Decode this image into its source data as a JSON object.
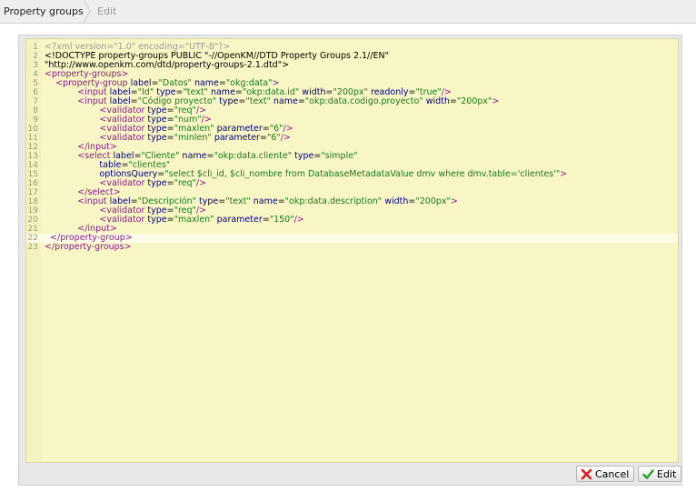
{
  "tabs": {
    "active": "Property groups",
    "inactive": "Edit"
  },
  "editor": {
    "lines": [
      {
        "n": "1",
        "segs": [
          [
            "meta",
            "<?xml version=\"1.0\" encoding=\"UTF-8\"?>"
          ]
        ]
      },
      {
        "n": "2",
        "segs": [
          [
            "text",
            "<!DOCTYPE property-groups PUBLIC \"-//OpenKM//DTD Property Groups 2.1//EN\""
          ]
        ]
      },
      {
        "n": "3",
        "segs": [
          [
            "text",
            "\"http://www.openkm.com/dtd/property-groups-2.1.dtd\">"
          ]
        ]
      },
      {
        "n": "4",
        "segs": [
          [
            "tag",
            "<property-groups>"
          ]
        ]
      },
      {
        "n": "5",
        "segs": [
          [
            "text",
            "    "
          ],
          [
            "tag",
            "<property-group "
          ],
          [
            "attr",
            "label"
          ],
          [
            "text",
            "="
          ],
          [
            "val",
            "\"Datos\""
          ],
          [
            "text",
            " "
          ],
          [
            "attr",
            "name"
          ],
          [
            "text",
            "="
          ],
          [
            "val",
            "\"okg:data\""
          ],
          [
            "tag",
            ">"
          ]
        ]
      },
      {
        "n": "6",
        "segs": [
          [
            "text",
            "            "
          ],
          [
            "tag",
            "<input "
          ],
          [
            "attr",
            "label"
          ],
          [
            "text",
            "="
          ],
          [
            "val",
            "\"Id\""
          ],
          [
            "text",
            " "
          ],
          [
            "attr",
            "type"
          ],
          [
            "text",
            "="
          ],
          [
            "val",
            "\"text\""
          ],
          [
            "text",
            " "
          ],
          [
            "attr",
            "name"
          ],
          [
            "text",
            "="
          ],
          [
            "val",
            "\"okp:data.id\""
          ],
          [
            "text",
            " "
          ],
          [
            "attr",
            "width"
          ],
          [
            "text",
            "="
          ],
          [
            "val",
            "\"200px\""
          ],
          [
            "text",
            " "
          ],
          [
            "attr",
            "readonly"
          ],
          [
            "text",
            "="
          ],
          [
            "val",
            "\"true\""
          ],
          [
            "tag",
            "/>"
          ]
        ]
      },
      {
        "n": "7",
        "segs": [
          [
            "text",
            "            "
          ],
          [
            "tag",
            "<input "
          ],
          [
            "attr",
            "label"
          ],
          [
            "text",
            "="
          ],
          [
            "val",
            "\"Código proyecto\""
          ],
          [
            "text",
            " "
          ],
          [
            "attr",
            "type"
          ],
          [
            "text",
            "="
          ],
          [
            "val",
            "\"text\""
          ],
          [
            "text",
            " "
          ],
          [
            "attr",
            "name"
          ],
          [
            "text",
            "="
          ],
          [
            "val",
            "\"okp:data.codigo.proyecto\""
          ],
          [
            "text",
            " "
          ],
          [
            "attr",
            "width"
          ],
          [
            "text",
            "="
          ],
          [
            "val",
            "\"200px\""
          ],
          [
            "tag",
            ">"
          ]
        ]
      },
      {
        "n": "8",
        "segs": [
          [
            "text",
            "                    "
          ],
          [
            "tag",
            "<validator "
          ],
          [
            "attr",
            "type"
          ],
          [
            "text",
            "="
          ],
          [
            "val",
            "\"req\""
          ],
          [
            "tag",
            "/>"
          ]
        ]
      },
      {
        "n": "9",
        "segs": [
          [
            "text",
            "                    "
          ],
          [
            "tag",
            "<validator "
          ],
          [
            "attr",
            "type"
          ],
          [
            "text",
            "="
          ],
          [
            "val",
            "\"num\""
          ],
          [
            "tag",
            "/>"
          ]
        ]
      },
      {
        "n": "10",
        "segs": [
          [
            "text",
            "                    "
          ],
          [
            "tag",
            "<validator "
          ],
          [
            "attr",
            "type"
          ],
          [
            "text",
            "="
          ],
          [
            "val",
            "\"maxlen\""
          ],
          [
            "text",
            " "
          ],
          [
            "attr",
            "parameter"
          ],
          [
            "text",
            "="
          ],
          [
            "val",
            "\"6\""
          ],
          [
            "tag",
            "/>"
          ]
        ]
      },
      {
        "n": "11",
        "segs": [
          [
            "text",
            "                    "
          ],
          [
            "tag",
            "<validator "
          ],
          [
            "attr",
            "type"
          ],
          [
            "text",
            "="
          ],
          [
            "val",
            "\"minlen\""
          ],
          [
            "text",
            " "
          ],
          [
            "attr",
            "parameter"
          ],
          [
            "text",
            "="
          ],
          [
            "val",
            "\"6\""
          ],
          [
            "tag",
            "/>"
          ]
        ]
      },
      {
        "n": "12",
        "segs": [
          [
            "text",
            "            "
          ],
          [
            "tag",
            "</input>"
          ]
        ]
      },
      {
        "n": "13",
        "segs": [
          [
            "text",
            "            "
          ],
          [
            "tag",
            "<select "
          ],
          [
            "attr",
            "label"
          ],
          [
            "text",
            "="
          ],
          [
            "val",
            "\"Cliente\""
          ],
          [
            "text",
            " "
          ],
          [
            "attr",
            "name"
          ],
          [
            "text",
            "="
          ],
          [
            "val",
            "\"okp:data.cliente\""
          ],
          [
            "text",
            " "
          ],
          [
            "attr",
            "type"
          ],
          [
            "text",
            "="
          ],
          [
            "val",
            "\"simple\""
          ]
        ]
      },
      {
        "n": "14",
        "segs": [
          [
            "text",
            "                    "
          ],
          [
            "attr",
            "table"
          ],
          [
            "text",
            "="
          ],
          [
            "val",
            "\"clientes\""
          ]
        ]
      },
      {
        "n": "15",
        "segs": [
          [
            "text",
            "                    "
          ],
          [
            "attr",
            "optionsQuery"
          ],
          [
            "text",
            "="
          ],
          [
            "val",
            "\"select $cli_id, $cli_nombre from DatabaseMetadataValue dmv where dmv.table='clientes'\""
          ],
          [
            "tag",
            ">"
          ]
        ]
      },
      {
        "n": "16",
        "segs": [
          [
            "text",
            "                    "
          ],
          [
            "tag",
            "<validator "
          ],
          [
            "attr",
            "type"
          ],
          [
            "text",
            "="
          ],
          [
            "val",
            "\"req\""
          ],
          [
            "tag",
            "/>"
          ]
        ]
      },
      {
        "n": "17",
        "segs": [
          [
            "text",
            "            "
          ],
          [
            "tag",
            "</select>"
          ]
        ]
      },
      {
        "n": "18",
        "segs": [
          [
            "text",
            "            "
          ],
          [
            "tag",
            "<input "
          ],
          [
            "attr",
            "label"
          ],
          [
            "text",
            "="
          ],
          [
            "val",
            "\"Descripción\""
          ],
          [
            "text",
            " "
          ],
          [
            "attr",
            "type"
          ],
          [
            "text",
            "="
          ],
          [
            "val",
            "\"text\""
          ],
          [
            "text",
            " "
          ],
          [
            "attr",
            "name"
          ],
          [
            "text",
            "="
          ],
          [
            "val",
            "\"okp:data.description\""
          ],
          [
            "text",
            " "
          ],
          [
            "attr",
            "width"
          ],
          [
            "text",
            "="
          ],
          [
            "val",
            "\"200px\""
          ],
          [
            "tag",
            ">"
          ]
        ]
      },
      {
        "n": "19",
        "segs": [
          [
            "text",
            "                    "
          ],
          [
            "tag",
            "<validator "
          ],
          [
            "attr",
            "type"
          ],
          [
            "text",
            "="
          ],
          [
            "val",
            "\"req\""
          ],
          [
            "tag",
            "/>"
          ]
        ]
      },
      {
        "n": "20",
        "segs": [
          [
            "text",
            "                    "
          ],
          [
            "tag",
            "<validator "
          ],
          [
            "attr",
            "type"
          ],
          [
            "text",
            "="
          ],
          [
            "val",
            "\"maxlen\""
          ],
          [
            "text",
            " "
          ],
          [
            "attr",
            "parameter"
          ],
          [
            "text",
            "="
          ],
          [
            "val",
            "\"150\""
          ],
          [
            "tag",
            "/>"
          ]
        ]
      },
      {
        "n": "21",
        "segs": [
          [
            "text",
            "            "
          ],
          [
            "tag",
            "</input>"
          ]
        ]
      },
      {
        "n": "22",
        "segs": [
          [
            "text",
            "  "
          ],
          [
            "tag",
            "</property-group>"
          ]
        ]
      },
      {
        "n": "23",
        "segs": [
          [
            "tag",
            "</property-groups>"
          ]
        ]
      }
    ],
    "active_line": "22"
  },
  "buttons": {
    "cancel_label": "Cancel",
    "edit_label": "Edit"
  },
  "icons": {
    "cancel": "close-x-icon",
    "edit": "check-icon"
  },
  "colors": {
    "editor_bg": "#f8f6c4",
    "tag": "#8a1a8a",
    "attr": "#000080",
    "value": "#1a7a1a"
  }
}
